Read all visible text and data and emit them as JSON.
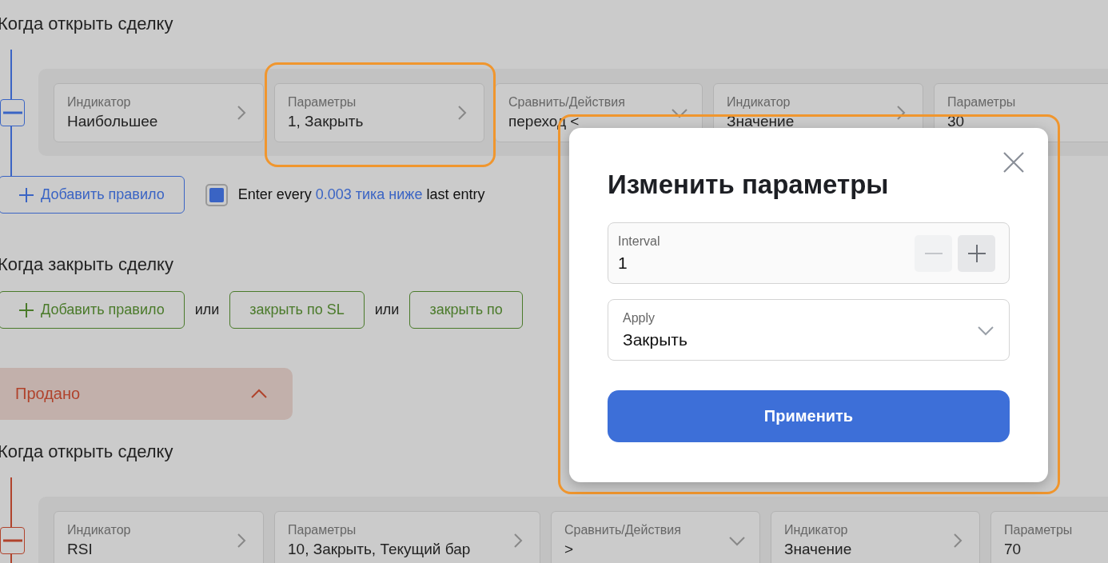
{
  "sections": [
    {
      "kind": "rules",
      "color": "#3a64c4",
      "title": "Когда открыть сделку",
      "cards": [
        {
          "kind": "link",
          "label": "Индикатор",
          "value": "Наибольшее"
        },
        {
          "kind": "link",
          "label": "Параметры",
          "value": "1, Закрыть"
        },
        {
          "kind": "dropdown",
          "label": "Сравнить/Действия",
          "value": "переход <"
        },
        {
          "kind": "link",
          "label": "Индикатор",
          "value": "Значение"
        },
        {
          "kind": "clipped",
          "label": "Параметры",
          "value": "30"
        }
      ],
      "add_button": "Добавить правило",
      "option": {
        "checked": true,
        "before": "Enter every",
        "link": "0.003 тика ниже",
        "after": "last entry"
      }
    },
    {
      "kind": "exits",
      "color": "#4a7a2a",
      "title": "Когда закрыть сделку",
      "items": [
        {
          "kind": "add",
          "text": "Добавить правило"
        },
        {
          "kind": "or",
          "text": "или"
        },
        {
          "kind": "button",
          "text": "закрыть по SL"
        },
        {
          "kind": "or",
          "text": "или"
        },
        {
          "kind": "button",
          "text": "закрыть по"
        }
      ]
    },
    {
      "kind": "group",
      "color": "#b0432c",
      "title": "Продано",
      "expanded": true
    },
    {
      "kind": "rules",
      "color": "#b0432c",
      "title": "Когда открыть сделку",
      "cards": [
        {
          "kind": "link",
          "label": "Индикатор",
          "value": "RSI"
        },
        {
          "kind": "link",
          "label": "Параметры",
          "value": "10, Закрыть, Текущий бар"
        },
        {
          "kind": "dropdown",
          "label": "Сравнить/Действия",
          "value": ">"
        },
        {
          "kind": "link",
          "label": "Индикатор",
          "value": "Значение"
        },
        {
          "kind": "clipped",
          "label": "Параметры",
          "value": "70"
        }
      ]
    }
  ],
  "dialog": {
    "title": "Изменить параметры",
    "fields": [
      {
        "kind": "stepper",
        "label": "Interval",
        "value": "1"
      },
      {
        "kind": "select",
        "label": "Apply",
        "value": "Закрыть"
      }
    ],
    "submit": "Применить"
  }
}
